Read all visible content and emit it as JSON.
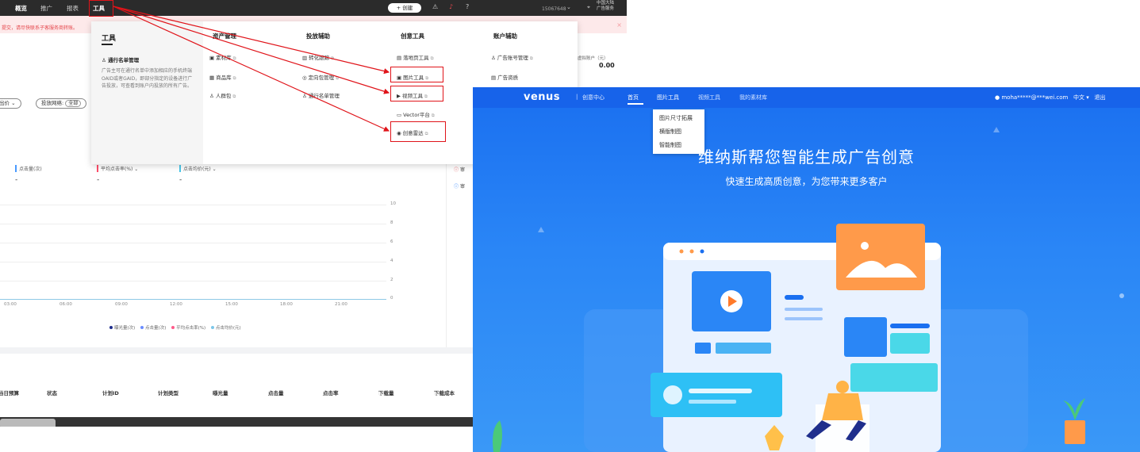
{
  "admin": {
    "nav": [
      "概览",
      "推广",
      "报表",
      "工具"
    ],
    "create_button": "+ 创建",
    "account_id": "15067648",
    "region": [
      "中国大陆",
      "广告服务"
    ],
    "notice": "提交，请尽快联系子客服务商转账。",
    "balance_label": "虚拟账户（元）",
    "balance_value": "0.00",
    "filters": {
      "bid": "出价",
      "network_label": "投放网络:",
      "network_value": "全部"
    },
    "metrics": [
      "点击量(次)",
      "平均点击率(%)",
      "点击均价(元)"
    ],
    "metric_dash": "-",
    "y_ticks": [
      "10",
      "8",
      "6",
      "4",
      "2",
      "0"
    ],
    "x_ticks": [
      "03:00",
      "06:00",
      "09:00",
      "12:00",
      "15:00",
      "18:00",
      "21:00"
    ],
    "legend": [
      "曝光量(次)",
      "点击量(次)",
      "平均点击率(%)",
      "点击均价(元)"
    ],
    "side_items": [
      "审",
      "审"
    ],
    "table_headers": [
      "当日预算",
      "状态",
      "计划ID",
      "计划类型",
      "曝光量",
      "点击量",
      "点击率",
      "下载量",
      "下载成本"
    ]
  },
  "tools_menu": {
    "title": "工具",
    "featured_title": "通行名单管理",
    "featured_desc": "广告主可在通行名单中添加相应的手机终端OAID或者GAID，即部分指定的设备进行广告投放，可查看到账户内投放的所有广告。",
    "columns": [
      {
        "head": "资产管理",
        "items": [
          "素材库",
          "商品库",
          "人群包"
        ]
      },
      {
        "head": "投放辅助",
        "items": [
          "转化跟踪",
          "定向包管理",
          "通行名单管理"
        ]
      },
      {
        "head": "创意工具",
        "items": [
          "落地页工具",
          "图片工具",
          "视频工具",
          "Vector平台",
          "创意雷达"
        ]
      },
      {
        "head": "账户辅助",
        "items": [
          "广告账号管理",
          "广告资质"
        ]
      }
    ]
  },
  "venus": {
    "logo": "venus",
    "sep": "|",
    "center": "创意中心",
    "tabs": [
      "首页",
      "图片工具",
      "视频工具",
      "我的素材库"
    ],
    "user": "moha*****@***wei.com",
    "lang": "中文",
    "logout": "退出",
    "dropdown": [
      "图片尺寸拓展",
      "横版制图",
      "智能制图"
    ],
    "headline": "维纳斯帮您智能生成广告创意",
    "subline": "快速生成高质创意，为您带来更多客户"
  },
  "colors": {
    "annotation_red": "#e0141a",
    "venus_blue": "#1a6ff0",
    "accent_orange": "#ff9a4a"
  }
}
